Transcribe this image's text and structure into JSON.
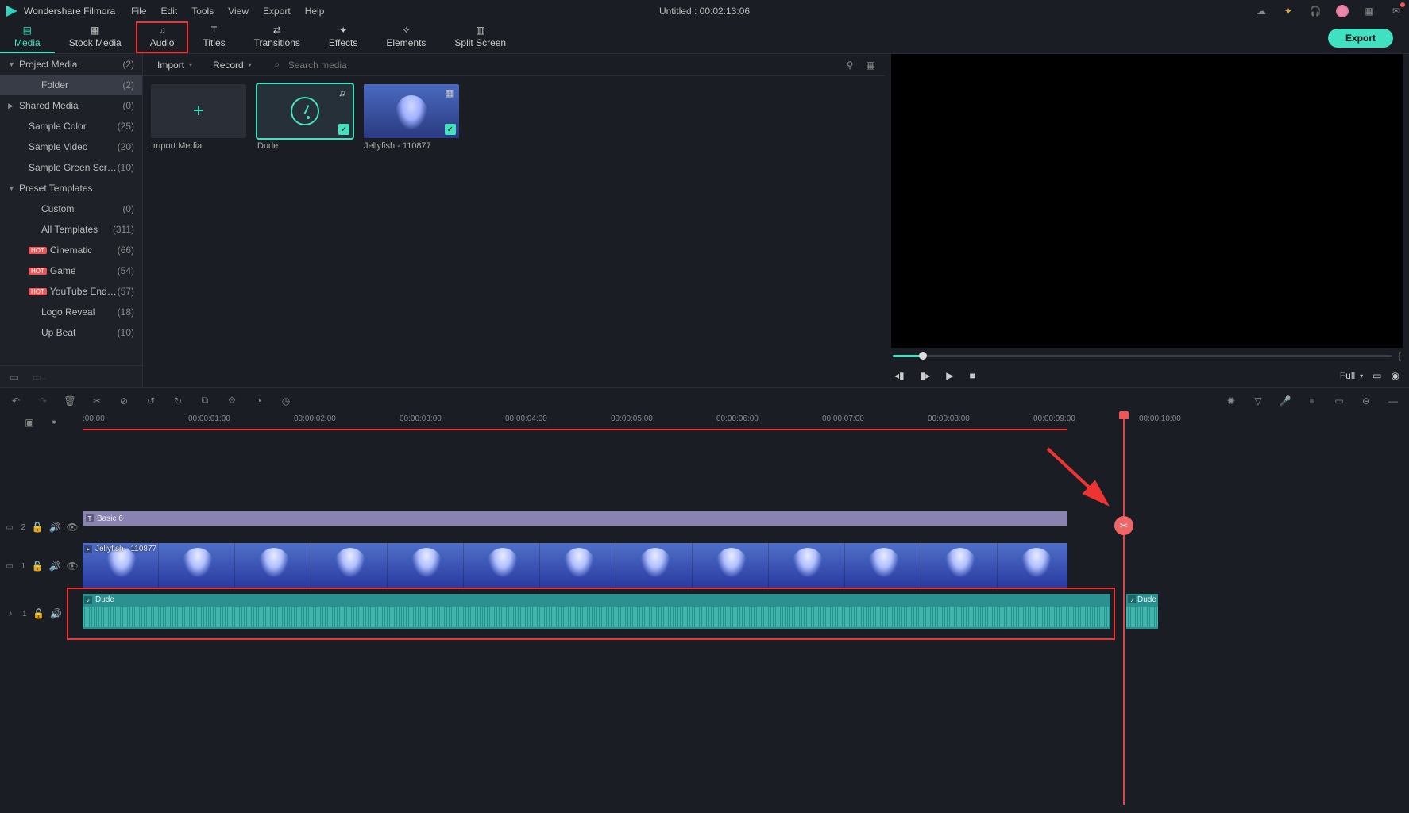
{
  "app": {
    "name": "Wondershare Filmora",
    "project_title": "Untitled : 00:02:13:06"
  },
  "menu": [
    "File",
    "Edit",
    "Tools",
    "View",
    "Export",
    "Help"
  ],
  "tabs": [
    {
      "label": "Media",
      "active": true
    },
    {
      "label": "Stock Media"
    },
    {
      "label": "Audio",
      "redbox": true
    },
    {
      "label": "Titles"
    },
    {
      "label": "Transitions"
    },
    {
      "label": "Effects"
    },
    {
      "label": "Elements"
    },
    {
      "label": "Split Screen"
    }
  ],
  "export_label": "Export",
  "sidebar": {
    "items": [
      {
        "label": "Project Media",
        "count": "(2)",
        "chev": "▼"
      },
      {
        "label": "Folder",
        "count": "(2)",
        "indent": 2,
        "sel": true
      },
      {
        "label": "Shared Media",
        "count": "(0)",
        "chev": "▶"
      },
      {
        "label": "Sample Color",
        "count": "(25)",
        "indent": 1
      },
      {
        "label": "Sample Video",
        "count": "(20)",
        "indent": 1
      },
      {
        "label": "Sample Green Scre...",
        "count": "(10)",
        "indent": 1
      },
      {
        "label": "Preset Templates",
        "chev": "▼"
      },
      {
        "label": "Custom",
        "count": "(0)",
        "indent": 2
      },
      {
        "label": "All Templates",
        "count": "(311)",
        "indent": 2
      },
      {
        "label": "Cinematic",
        "count": "(66)",
        "indent": 1,
        "hot": true
      },
      {
        "label": "Game",
        "count": "(54)",
        "indent": 1,
        "hot": true
      },
      {
        "label": "YouTube Endscr...",
        "count": "(57)",
        "indent": 1,
        "hot": true
      },
      {
        "label": "Logo Reveal",
        "count": "(18)",
        "indent": 2
      },
      {
        "label": "Up Beat",
        "count": "(10)",
        "indent": 2
      }
    ]
  },
  "browser": {
    "import": "Import",
    "record": "Record",
    "search_ph": "Search media",
    "thumbs": [
      {
        "label": "Import Media",
        "type": "import"
      },
      {
        "label": "Dude",
        "type": "audio",
        "sel": true
      },
      {
        "label": "Jellyfish - 110877",
        "type": "jelly"
      }
    ]
  },
  "preview": {
    "quality": "Full"
  },
  "ruler": {
    "ticks": [
      ":00:00",
      "00:00:01:00",
      "00:00:02:00",
      "00:00:03:00",
      "00:00:04:00",
      "00:00:05:00",
      "00:00:06:00",
      "00:00:07:00",
      "00:00:08:00",
      "00:00:09:00",
      "00:00:10:00"
    ]
  },
  "tracks": {
    "title_track_num": "2",
    "video_track_num": "1",
    "audio_track_num": "1",
    "title_clip": "Basic 6",
    "video_clip": "Jellyfish - 110877",
    "audio_clip": "Dude",
    "audio_clip2": "Dude"
  },
  "icons": {
    "note": "♪",
    "video": "▸",
    "pic": "▦",
    "lock": "🔒",
    "eye": "👁",
    "vol": "🔊"
  }
}
